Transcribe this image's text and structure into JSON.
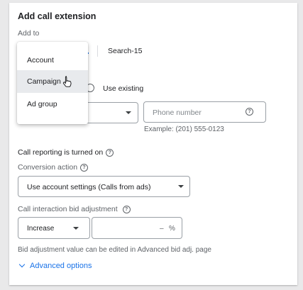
{
  "header": {
    "title": "Add call extension",
    "add_to_label": "Add to"
  },
  "level_selector": {
    "selected_value": "Search-15"
  },
  "level_menu": {
    "items": [
      {
        "label": "Account"
      },
      {
        "label": "Campaign"
      },
      {
        "label": "Ad group"
      }
    ],
    "hovered_index": 1
  },
  "source_choice": {
    "use_existing_label": "Use existing"
  },
  "phone": {
    "placeholder": "Phone number",
    "example": "Example: (201) 555-0123"
  },
  "reporting": {
    "status_text": "Call reporting is turned on",
    "conversion_label": "Conversion action",
    "conversion_value": "Use account settings (Calls from ads)"
  },
  "bid": {
    "label": "Call interaction bid adjustment",
    "direction_value": "Increase",
    "dash": "–",
    "percent": "%",
    "note": "Bid adjustment value can be edited in Advanced bid adj. page"
  },
  "advanced": {
    "label": "Advanced options"
  },
  "colors": {
    "accent": "#1a73e8",
    "text": "#202124",
    "muted": "#5f6368",
    "border": "#9aa0a6",
    "menu_hover": "#e8eaed"
  }
}
